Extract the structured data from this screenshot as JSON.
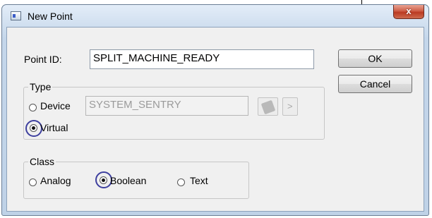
{
  "window": {
    "title": "New Point",
    "close_glyph": "x"
  },
  "point_id": {
    "label": "Point ID:",
    "value": "SPLIT_MACHINE_READY"
  },
  "buttons": {
    "ok": "OK",
    "cancel": "Cancel"
  },
  "type_group": {
    "legend": "Type",
    "device_label": "Device",
    "device_value": "SYSTEM_SENTRY",
    "virtual_label": "Virtual",
    "selected": "Virtual",
    "browse_icon": "database-icon",
    "arrow_glyph": ">"
  },
  "class_group": {
    "legend": "Class",
    "options": [
      "Analog",
      "Boolean",
      "Text"
    ],
    "selected": "Boolean"
  },
  "colors": {
    "highlight_ring": "#3d3f9e",
    "close_button": "#c4452d"
  }
}
